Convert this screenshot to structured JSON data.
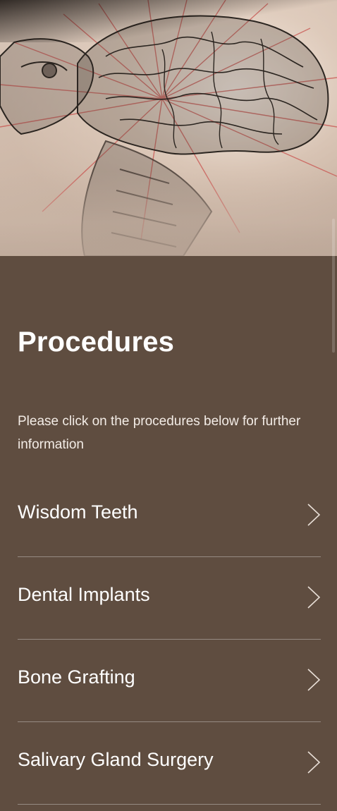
{
  "hero": {
    "icon": "brain-anatomy-illustration"
  },
  "section": {
    "title": "Procedures",
    "intro": "Please click on the procedures below for further information"
  },
  "procedures": [
    {
      "label": "Wisdom Teeth",
      "icon": "chevron-right-icon"
    },
    {
      "label": "Dental Implants",
      "icon": "chevron-right-icon"
    },
    {
      "label": "Bone Grafting",
      "icon": "chevron-right-icon"
    },
    {
      "label": "Salivary Gland Surgery",
      "icon": "chevron-right-icon"
    }
  ],
  "colors": {
    "background": "#5f4d40",
    "text": "#ffffff",
    "divider": "rgba(255,255,255,0.35)"
  }
}
